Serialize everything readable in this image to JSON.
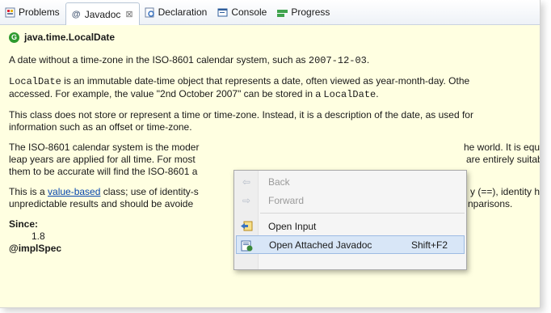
{
  "tabs": [
    {
      "label": "Problems",
      "icon": "problems-icon"
    },
    {
      "label": "Javadoc",
      "icon": "at-icon",
      "active": true
    },
    {
      "label": "Declaration",
      "icon": "declaration-icon"
    },
    {
      "label": "Console",
      "icon": "console-icon"
    },
    {
      "label": "Progress",
      "icon": "progress-icon"
    }
  ],
  "tab_close_glyph": "⊠",
  "doc": {
    "class_icon": "G",
    "title": "java.time.LocalDate",
    "p1_a": "A date without a time-zone in the ISO-8601 calendar system, such as ",
    "p1_code": "2007-12-03",
    "p1_b": ".",
    "p2_code": "LocalDate",
    "p2_a": " is an immutable date-time object that represents a date, often viewed as year-month-day. Othe",
    "p2_b": "accessed. For example, the value \"2nd October 2007\" can be stored in a ",
    "p2_code2": "LocalDate",
    "p2_c": ".",
    "p3_a": "This class does not store or represent a time or time-zone. Instead, it is a description of the date, as used for",
    "p3_b": "information such as an offset or time-zone.",
    "p4_a": "The ISO-8601 calendar system is the moder",
    "p4_a2": "he world. It is equ",
    "p4_b": "leap years are applied for all time. For most",
    "p4_b2": "are entirely suitabl",
    "p4_c": "them to be accurate will find the ISO-8601 a",
    "p5_a": "This is a ",
    "p5_link": "value-based",
    "p5_b": " class; use of identity-s",
    "p5_b2": "y (==), identity ha",
    "p5_c": "unpredictable results and should be avoide",
    "p5_c2": "nparisons.",
    "since_label": "Since:",
    "since_value": "1.8",
    "impl_label": "@implSpec"
  },
  "menu": {
    "items": [
      {
        "label": "Back",
        "icon": "back-arrow-icon",
        "glyph": "⇦",
        "disabled": true
      },
      {
        "label": "Forward",
        "icon": "forward-arrow-icon",
        "glyph": "⇨",
        "disabled": true
      },
      {
        "label": "Open Input",
        "icon": "open-input-icon",
        "glyph": "⇦"
      },
      {
        "label": "Open Attached Javadoc",
        "icon": "attached-javadoc-icon",
        "glyph": "◙",
        "accelerator": "Shift+F2",
        "highlighted": true
      }
    ]
  }
}
